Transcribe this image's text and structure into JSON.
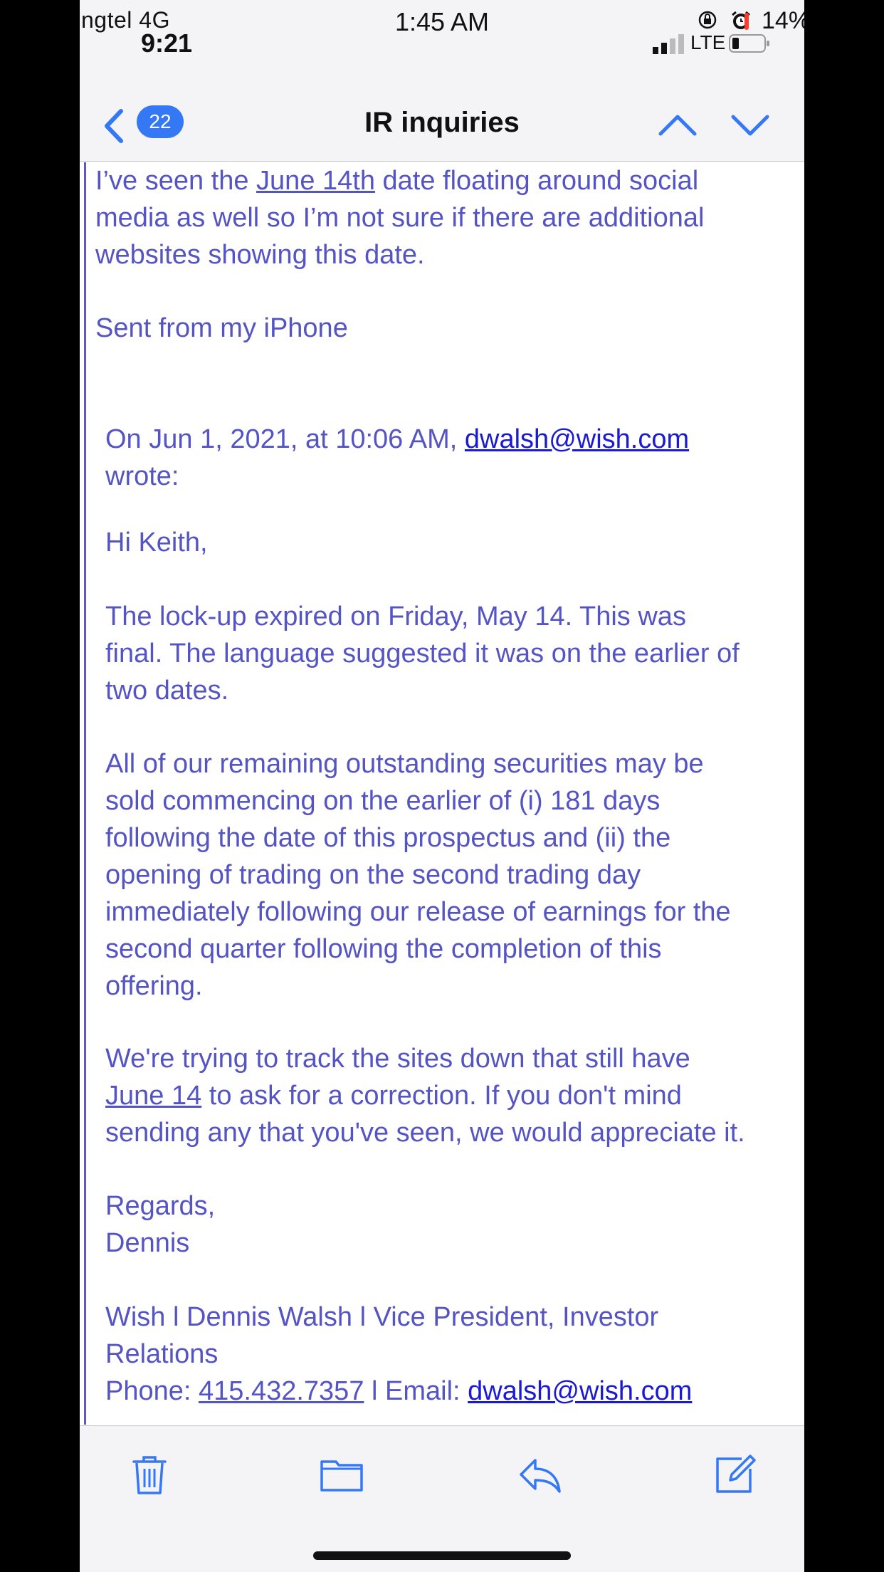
{
  "status_bar": {
    "carrier": "ngtel  4G",
    "small_time": "9:21",
    "time": "1:45 AM",
    "battery_percent": "14%",
    "network": "LTE"
  },
  "nav": {
    "back_count": "22",
    "title": "IR inquiries"
  },
  "email": {
    "intro_before": "I’ve seen the ",
    "intro_date": "June 14th",
    "intro_after_1": " date floating around social",
    "intro_line_2": "media as well so I’m not sure if there are additional",
    "intro_line_3": "websites showing this date.",
    "signature": "Sent from my iPhone",
    "quote_header_before": "On Jun 1, 2021, at 10:06 AM, ",
    "quote_header_email": "dwalsh@wish.com",
    "quote_header_after": "wrote:",
    "greeting": "Hi Keith,",
    "p1_line_1": "The lock-up expired on Friday, May 14. This was",
    "p1_line_2": "final. The language suggested it was on the earlier of",
    "p1_line_3": "two dates.",
    "p2_line_1": "All of our remaining outstanding securities may be",
    "p2_line_2": "sold commencing on the earlier of (i) 181 days",
    "p2_line_3": "following the date of this prospectus and (ii) the",
    "p2_line_4": "opening of trading on the second trading day",
    "p2_line_5": "immediately following our release of earnings for the",
    "p2_line_6": "second quarter following the completion of this",
    "p2_line_7": "offering.",
    "p3_line_1": "We're trying to track the sites down that still have",
    "p3_date": "June 14",
    "p3_line_2_after": " to ask for a correction. If you don't mind",
    "p3_line_3": "sending any that you've seen, we would appreciate it.",
    "regards": "Regards,",
    "name": "Dennis",
    "sig_line_1": "Wish l Dennis Walsh l Vice President, Investor",
    "sig_line_2": "Relations",
    "phone_label": "Phone: ",
    "phone": "415.432.7357",
    "email_label": " l Email: ",
    "sig_email": "dwalsh@wish.com"
  },
  "toolbar": {
    "icons": [
      "trash-icon",
      "folder-icon",
      "reply-icon",
      "compose-icon"
    ]
  },
  "colors": {
    "quoted_text": "#5554c4",
    "link": "#1a1ad4",
    "accent": "#3478f6"
  }
}
